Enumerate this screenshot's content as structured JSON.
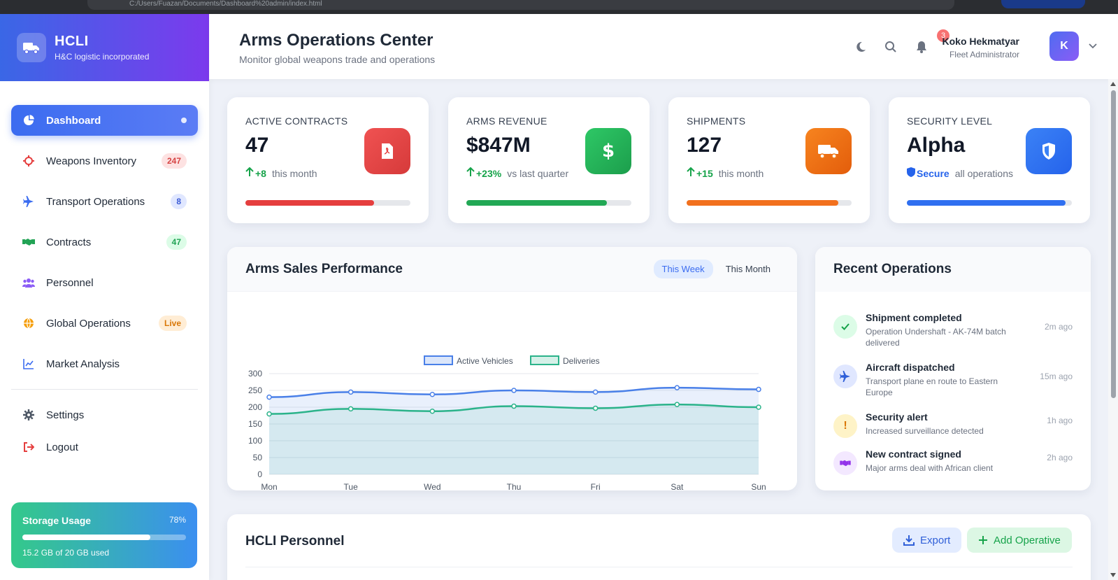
{
  "browser": {
    "url": "C:/Users/Fuazan/Documents/Dashboard%20admin/index.html"
  },
  "brand": {
    "name": "HCLI",
    "tagline": "H&C logistic incorporated"
  },
  "sidebar": {
    "items": [
      {
        "label": "Dashboard",
        "icon": "pie-chart-icon",
        "badge": null,
        "active": true
      },
      {
        "label": "Weapons Inventory",
        "icon": "crosshair-icon",
        "badge": "247"
      },
      {
        "label": "Transport Operations",
        "icon": "plane-icon",
        "badge": "8"
      },
      {
        "label": "Contracts",
        "icon": "handshake-icon",
        "badge": "47"
      },
      {
        "label": "Personnel",
        "icon": "users-icon",
        "badge": null
      },
      {
        "label": "Global Operations",
        "icon": "globe-icon",
        "badge": "Live"
      },
      {
        "label": "Market Analysis",
        "icon": "line-chart-icon",
        "badge": null
      }
    ],
    "settings_label": "Settings",
    "logout_label": "Logout"
  },
  "storage": {
    "title": "Storage Usage",
    "percent_label": "78%",
    "percent": 0.78,
    "note": "15.2 GB of 20 GB used"
  },
  "header": {
    "title": "Arms Operations Center",
    "subtitle": "Monitor global weapons trade and operations",
    "notification_count": "3",
    "user_name": "Koko Hekmatyar",
    "user_role": "Fleet Administrator",
    "avatar_initial": "K"
  },
  "stats": [
    {
      "label": "ACTIVE CONTRACTS",
      "value": "47",
      "delta": "+8",
      "note": "this month",
      "color": "#e53e3e",
      "fill": 0.78,
      "icon": "pdf-file-icon"
    },
    {
      "label": "ARMS REVENUE",
      "value": "$847M",
      "delta": "+23%",
      "note": "vs last quarter",
      "color": "#22a855",
      "fill": 0.85,
      "icon": "dollar-icon"
    },
    {
      "label": "SHIPMENTS",
      "value": "127",
      "delta": "+15",
      "note": "this month",
      "color": "#f2701d",
      "fill": 0.92,
      "icon": "truck-icon"
    },
    {
      "label": "SECURITY LEVEL",
      "value": "Alpha",
      "delta": "Secure",
      "note": "all operations",
      "color": "#2f6ff0",
      "fill": 0.96,
      "icon": "shield-icon"
    }
  ],
  "chart": {
    "title": "Arms Sales Performance",
    "tab_week": "This Week",
    "tab_month": "This Month"
  },
  "chart_data": {
    "type": "line",
    "x": [
      "Mon",
      "Tue",
      "Wed",
      "Thu",
      "Fri",
      "Sat",
      "Sun"
    ],
    "series": [
      {
        "name": "Active Vehicles",
        "values": [
          230,
          245,
          238,
          250,
          245,
          258,
          253
        ],
        "color": "#4a80e8"
      },
      {
        "name": "Deliveries",
        "values": [
          180,
          195,
          188,
          203,
          197,
          208,
          200
        ],
        "color": "#2bb38a"
      }
    ],
    "yticks": [
      0,
      50,
      100,
      150,
      200,
      250,
      300
    ],
    "ylim": [
      0,
      300
    ],
    "legend": "top-center",
    "grid": true,
    "area_fill": true
  },
  "recent_ops": {
    "title": "Recent Operations",
    "items": [
      {
        "title": "Shipment completed",
        "desc": "Operation Undershaft - AK-74M batch delivered",
        "time": "2m ago",
        "icon": "check-icon",
        "bg": "#dcfce7",
        "fg": "#16a34a"
      },
      {
        "title": "Aircraft dispatched",
        "desc": "Transport plane en route to Eastern Europe",
        "time": "15m ago",
        "icon": "plane-icon",
        "bg": "#e0e7ff",
        "fg": "#2f5fd8"
      },
      {
        "title": "Security alert",
        "desc": "Increased surveillance detected",
        "time": "1h ago",
        "icon": "exclamation-icon",
        "bg": "#fef3c7",
        "fg": "#d97706"
      },
      {
        "title": "New contract signed",
        "desc": "Major arms deal with African client",
        "time": "2h ago",
        "icon": "handshake-icon",
        "bg": "#f3e8ff",
        "fg": "#9333ea"
      }
    ]
  },
  "personnel": {
    "title": "HCLI Personnel",
    "export_label": "Export",
    "add_label": "Add Operative"
  }
}
